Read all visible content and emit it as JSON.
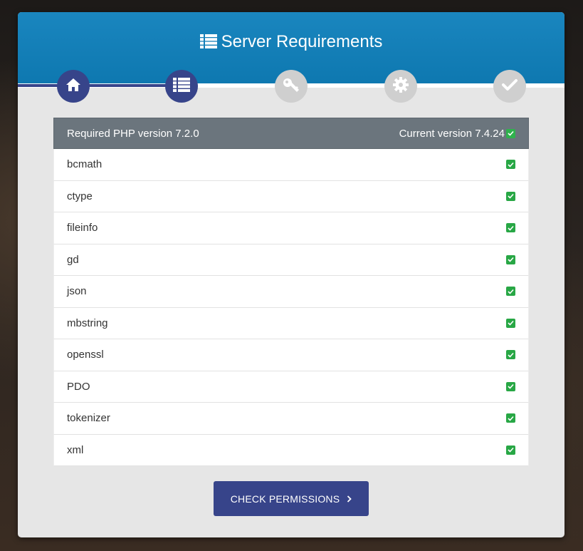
{
  "header": {
    "title": "Server Requirements",
    "title_icon": "list-icon",
    "accent_color": "#0e78b0"
  },
  "steps": [
    {
      "icon": "home-icon",
      "state": "done"
    },
    {
      "icon": "list-icon",
      "state": "done"
    },
    {
      "icon": "key-icon",
      "state": "pending"
    },
    {
      "icon": "gear-icon",
      "state": "pending"
    },
    {
      "icon": "check-icon",
      "state": "pending"
    }
  ],
  "requirements": {
    "required_label": "Required PHP version 7.2.0",
    "current_label": "Current version 7.4.24",
    "current_ok": true,
    "extensions": [
      {
        "name": "bcmath",
        "ok": true
      },
      {
        "name": "ctype",
        "ok": true
      },
      {
        "name": "fileinfo",
        "ok": true
      },
      {
        "name": "gd",
        "ok": true
      },
      {
        "name": "json",
        "ok": true
      },
      {
        "name": "mbstring",
        "ok": true
      },
      {
        "name": "openssl",
        "ok": true
      },
      {
        "name": "PDO",
        "ok": true
      },
      {
        "name": "tokenizer",
        "ok": true
      },
      {
        "name": "xml",
        "ok": true
      }
    ]
  },
  "actions": {
    "check_permissions_label": "CHECK PERMISSIONS",
    "button_color": "#37448a"
  }
}
